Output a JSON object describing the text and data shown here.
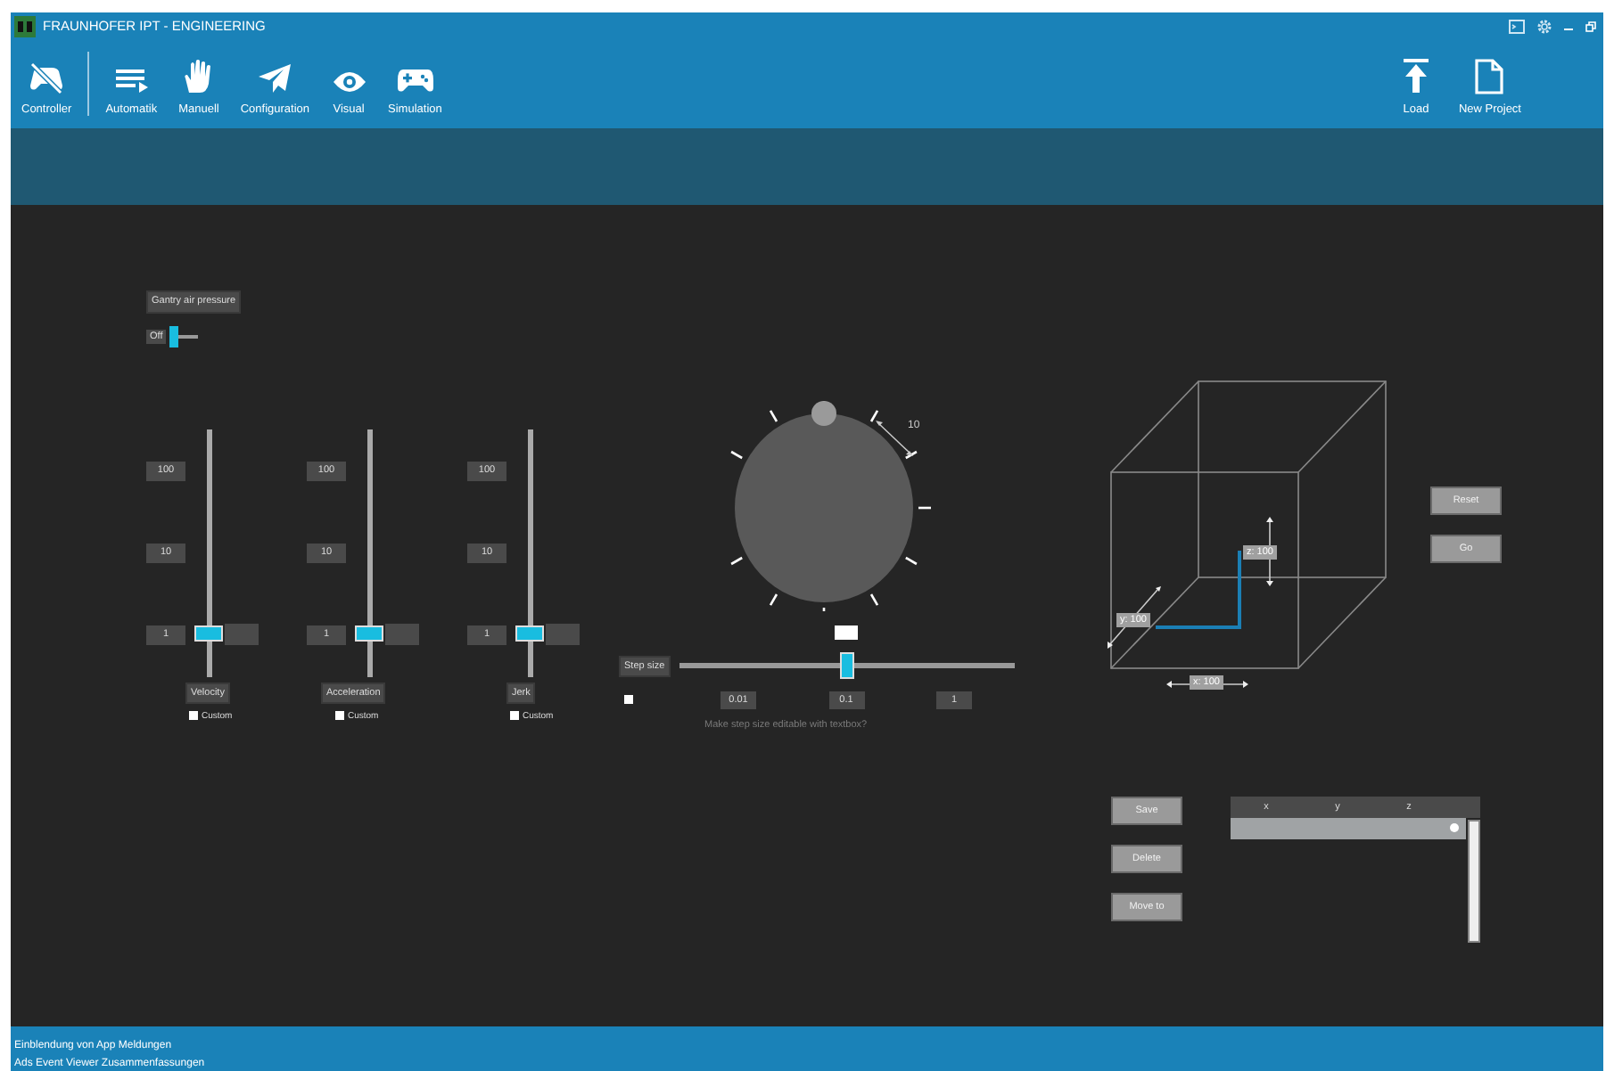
{
  "window": {
    "title": "FRAUNHOFER IPT - ENGINEERING"
  },
  "toolbar": {
    "main": [
      {
        "label": "Controller"
      }
    ],
    "modes": [
      {
        "label": "Automatik"
      },
      {
        "label": "Manuell"
      },
      {
        "label": "Configuration"
      },
      {
        "label": "Visual"
      },
      {
        "label": "Simulation"
      }
    ],
    "actions": [
      {
        "label": "Load"
      },
      {
        "label": "New Project"
      }
    ]
  },
  "gantry": {
    "button": "Gantry air pressure",
    "toggle": {
      "label": "Off",
      "on": false
    }
  },
  "sliders": [
    {
      "name": "Velocity",
      "ticks": [
        "100",
        "10",
        "1"
      ],
      "level": 0.17,
      "custom": {
        "label": "Custom",
        "checked": false
      }
    },
    {
      "name": "Acceleration",
      "ticks": [
        "100",
        "10",
        "1"
      ],
      "level": 0.17,
      "custom": {
        "label": "Custom",
        "checked": false
      }
    },
    {
      "name": "Jerk",
      "ticks": [
        "100",
        "10",
        "1"
      ],
      "level": 0.17,
      "custom": {
        "label": "Custom",
        "checked": false
      }
    }
  ],
  "dial": {
    "marker": "10"
  },
  "step": {
    "button": "Step size",
    "level": 0.5,
    "ticks": [
      "0.01",
      "0.1",
      "1"
    ],
    "editable": {
      "checked": false
    },
    "hint": "Make step size editable with textbox?"
  },
  "cube": {
    "x_label": "x: 100",
    "y_label": "y: 100",
    "z_label": "z: 100"
  },
  "position_buttons": [
    "Reset",
    "Go"
  ],
  "list_buttons": [
    "Save",
    "Delete",
    "Move to"
  ],
  "table": {
    "columns": [
      "x",
      "y",
      "z"
    ],
    "rows": [
      {
        "selected": true
      }
    ]
  },
  "status_bar": [
    "Einblendung von App Meldungen",
    "Ads Event Viewer Zusammenfassungen"
  ]
}
